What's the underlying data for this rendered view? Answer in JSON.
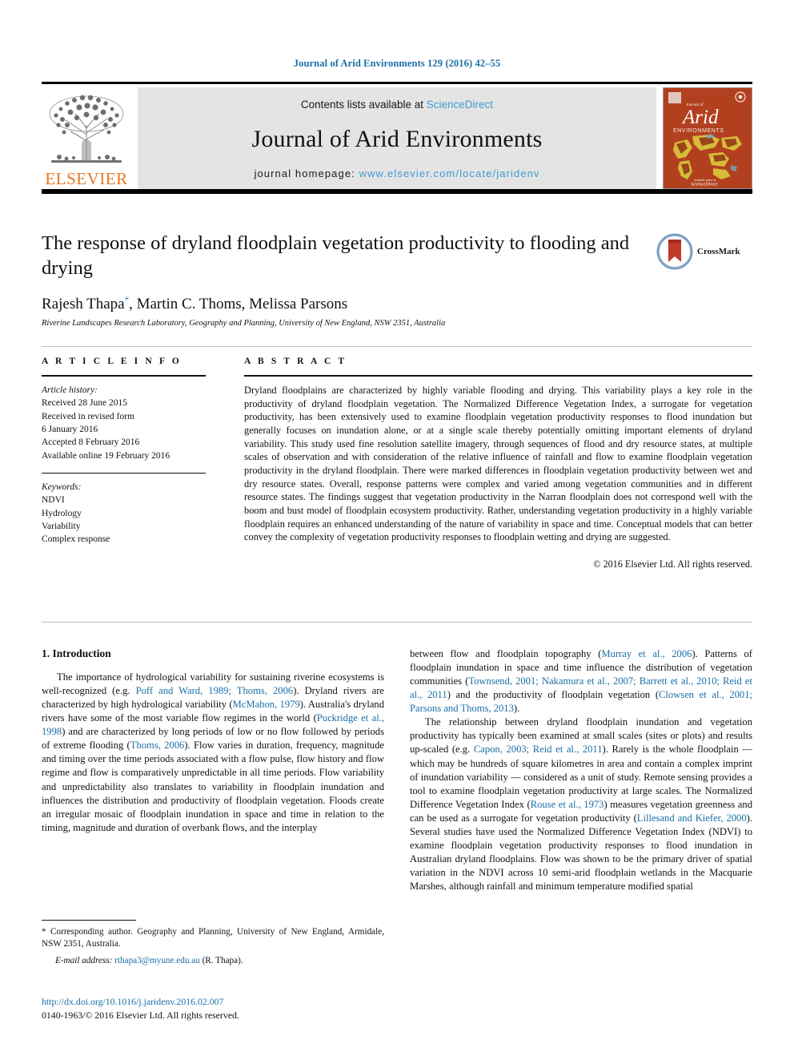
{
  "running_head": "Journal of Arid Environments 129 (2016) 42–55",
  "masthead": {
    "publisher_name": "ELSEVIER",
    "contents_prefix": "Contents lists available at",
    "contents_link": "ScienceDirect",
    "journal_title": "Journal of Arid Environments",
    "homepage_prefix": "journal homepage:",
    "homepage_url": "www.elsevier.com/locate/jaridenv",
    "cover_journal_of": "Journal of",
    "cover_title": "Arid",
    "cover_subtitle": "ENVIRONMENTS",
    "cover_publisher": "Elsevier"
  },
  "article": {
    "title": "The response of dryland floodplain vegetation productivity to flooding and drying",
    "authors": "Rajesh Thapa, Martin C. Thoms, Melissa Parsons",
    "author_corresponding_marker": "*",
    "affiliation": "Riverine Landscapes Research Laboratory, Geography and Planning, University of New England, NSW 2351, Australia",
    "crossmark_label": "CrossMark"
  },
  "article_info": {
    "heading": "A R T I C L E   I N F O",
    "history_label": "Article history:",
    "history": [
      "Received 28 June 2015",
      "Received in revised form",
      "6 January 2016",
      "Accepted 8 February 2016",
      "Available online 19 February 2016"
    ],
    "keywords_label": "Keywords:",
    "keywords": [
      "NDVI",
      "Hydrology",
      "Variability",
      "Complex response"
    ]
  },
  "abstract": {
    "heading": "A B S T R A C T",
    "text": "Dryland floodplains are characterized by highly variable flooding and drying. This variability plays a key role in the productivity of dryland floodplain vegetation. The Normalized Difference Vegetation Index, a surrogate for vegetation productivity, has been extensively used to examine floodplain vegetation productivity responses to flood inundation but generally focuses on inundation alone, or at a single scale thereby potentially omitting important elements of dryland variability. This study used fine resolution satellite imagery, through sequences of flood and dry resource states, at multiple scales of observation and with consideration of the relative influence of rainfall and flow to examine floodplain vegetation productivity in the dryland floodplain. There were marked differences in floodplain vegetation productivity between wet and dry resource states. Overall, response patterns were complex and varied among vegetation communities and in different resource states. The findings suggest that vegetation productivity in the Narran floodplain does not correspond well with the boom and bust model of floodplain ecosystem productivity. Rather, understanding vegetation productivity in a highly variable floodplain requires an enhanced understanding of the nature of variability in space and time. Conceptual models that can better convey the complexity of vegetation productivity responses to floodplain wetting and drying are suggested.",
    "copyright": "© 2016 Elsevier Ltd. All rights reserved."
  },
  "introduction": {
    "heading": "1. Introduction",
    "left_paragraph_parts": [
      "The importance of hydrological variability for sustaining riverine ecosystems is well-recognized (e.g. ",
      "Poff and Ward, 1989; Thoms, 2006",
      "). Dryland rivers are characterized by high hydrological variability (",
      "McMahon, 1979",
      "). Australia's dryland rivers have some of the most variable flow regimes in the world (",
      "Puckridge et al., 1998",
      ") and are characterized by long periods of low or no flow followed by periods of extreme flooding (",
      "Thoms, 2006",
      "). Flow varies in duration, frequency, magnitude and timing over the time periods associated with a flow pulse, flow history and flow regime and flow is comparatively unpredictable in all time periods. Flow variability and unpredictability also translates to variability in floodplain inundation and influences the distribution and productivity of floodplain vegetation. Floods create an irregular mosaic of floodplain inundation in space and time in relation to the timing, magnitude and duration of overbank flows, and the interplay"
    ],
    "right_paragraph1_parts": [
      "between flow and floodplain topography (",
      "Murray et al., 2006",
      "). Patterns of floodplain inundation in space and time influence the distribution of vegetation communities (",
      "Townsend, 2001; Nakamura et al., 2007; Barrett et al., 2010; Reid et al., 2011",
      ") and the productivity of floodplain vegetation (",
      "Clowsen et al., 2001; Parsons and Thoms, 2013",
      ")."
    ],
    "right_paragraph2_parts": [
      "The relationship between dryland floodplain inundation and vegetation productivity has typically been examined at small scales (sites or plots) and results up-scaled (e.g. ",
      "Capon, 2003; Reid et al., 2011",
      "). Rarely is the whole floodplain — which may be hundreds of square kilometres in area and contain a complex imprint of inundation variability — considered as a unit of study. Remote sensing provides a tool to examine floodplain vegetation productivity at large scales. The Normalized Difference Vegetation Index (",
      "Rouse et al., 1973",
      ") measures vegetation greenness and can be used as a surrogate for vegetation productivity (",
      "Lillesand and Kiefer, 2000",
      "). Several studies have used the Normalized Difference Vegetation Index (NDVI) to examine floodplain vegetation productivity responses to flood inundation in Australian dryland floodplains. Flow was shown to be the primary driver of spatial variation in the NDVI across 10 semi-arid floodplain wetlands in the Macquarie Marshes, although rainfall and minimum temperature modified spatial"
    ]
  },
  "footnote": {
    "marker": "*",
    "corresponding_text": "Corresponding author. Geography and Planning, University of New England, Armidale, NSW 2351, Australia.",
    "email_label": "E-mail address:",
    "email": "rthapa3@myune.edu.au",
    "email_attribution": "(R. Thapa)."
  },
  "footer": {
    "doi": "http://dx.doi.org/10.1016/j.jaridenv.2016.02.007",
    "issn_line": "0140-1963/© 2016 Elsevier Ltd. All rights reserved."
  },
  "colors": {
    "link_blue": "#1a6ea8",
    "science_direct_blue": "#3d9bd1",
    "elsevier_orange": "#E87722",
    "cover_red": "#b2401f"
  }
}
